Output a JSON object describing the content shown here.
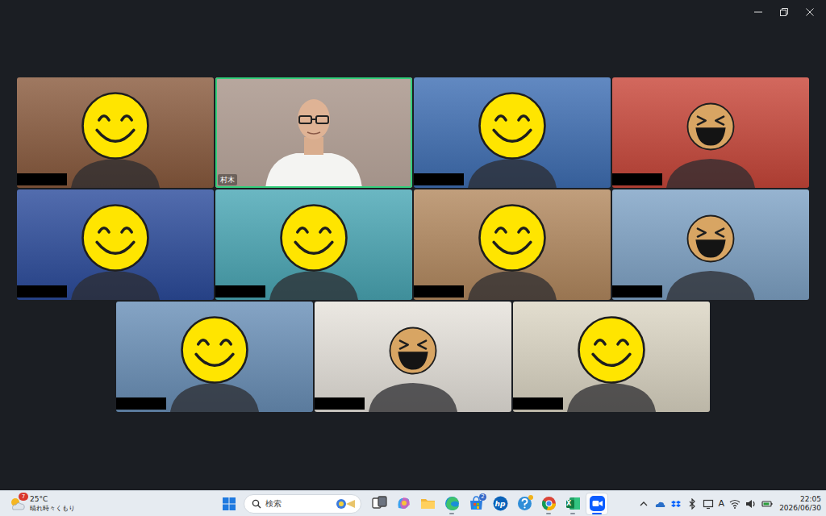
{
  "meeting": {
    "tile_rows": [
      [
        {
          "name_hidden": true,
          "active_speaker": false,
          "kind": "smile",
          "color": "#8a5b3e"
        },
        {
          "name": "村木",
          "name_hidden": false,
          "active_speaker": true,
          "kind": "camera",
          "color": "#a8968c"
        },
        {
          "name_hidden": true,
          "active_speaker": false,
          "kind": "smile",
          "color": "#3f6fb4"
        },
        {
          "name_hidden": true,
          "active_speaker": false,
          "kind": "laugh",
          "color": "#c9473a"
        }
      ],
      [
        {
          "name_hidden": true,
          "active_speaker": false,
          "kind": "smile",
          "color": "#2c4c9c"
        },
        {
          "name_hidden": true,
          "active_speaker": false,
          "kind": "smile",
          "color": "#4aa7b5"
        },
        {
          "name_hidden": true,
          "active_speaker": false,
          "kind": "smile",
          "color": "#b3895f"
        },
        {
          "name_hidden": true,
          "active_speaker": false,
          "kind": "laugh",
          "color": "#7fa3c6"
        }
      ],
      [
        {
          "name_hidden": true,
          "active_speaker": false,
          "kind": "smile",
          "color": "#6a90b8"
        },
        {
          "name_hidden": true,
          "active_speaker": false,
          "kind": "laugh",
          "color": "#e7e3dc"
        },
        {
          "name_hidden": true,
          "active_speaker": false,
          "kind": "smile",
          "color": "#dcd6c4"
        }
      ]
    ]
  },
  "taskbar": {
    "weather": {
      "badge": "7",
      "temperature": "25°C",
      "condition": "晴れ時々くもり"
    },
    "search": {
      "placeholder": "検索"
    },
    "apps": [
      {
        "kind": "task-view",
        "running": false,
        "active": false,
        "dot": false
      },
      {
        "kind": "copilot",
        "running": false,
        "active": false,
        "dot": false
      },
      {
        "kind": "explorer",
        "running": false,
        "active": false,
        "dot": false
      },
      {
        "kind": "edge",
        "running": true,
        "active": false,
        "dot": false
      },
      {
        "kind": "store",
        "running": false,
        "active": false,
        "dot": false,
        "badge": "2"
      },
      {
        "kind": "hp",
        "glyph": "hp",
        "running": false,
        "active": false,
        "dot": false
      },
      {
        "kind": "help",
        "running": false,
        "active": false,
        "dot": true
      },
      {
        "kind": "chrome",
        "running": true,
        "active": false,
        "dot": false
      },
      {
        "kind": "excel",
        "glyph": "X",
        "running": true,
        "active": false,
        "dot": false
      },
      {
        "kind": "zoom",
        "running": true,
        "active": true,
        "dot": false
      }
    ],
    "ime": "A",
    "clock": {
      "time": "22:05",
      "date": "2026/06/30"
    }
  }
}
